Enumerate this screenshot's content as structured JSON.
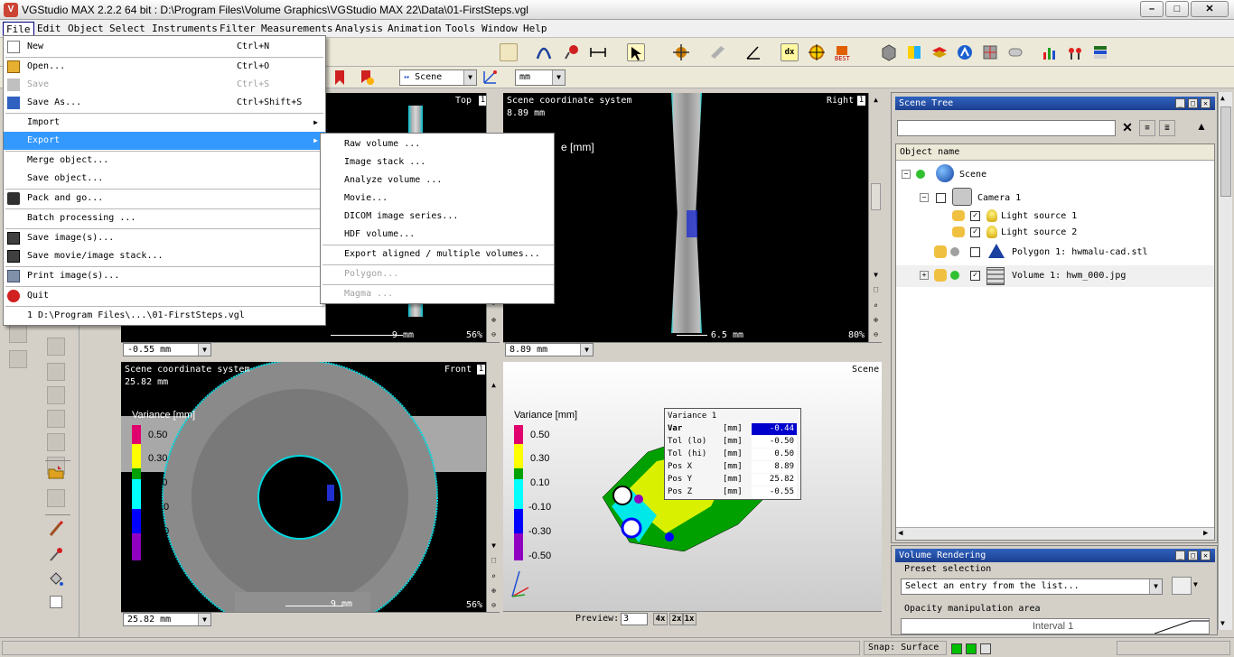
{
  "window": {
    "title": "VGStudio MAX 2.2.2 64 bit : D:\\Program Files\\Volume Graphics\\VGStudio MAX 22\\Data\\01-FirstSteps.vgl",
    "min_label": "–",
    "max_label": "□",
    "close_label": "✕"
  },
  "menubar": [
    "File",
    "Edit",
    "Object",
    "Select",
    "Instruments",
    "Filter",
    "Measurements",
    "Analysis",
    "Animation",
    "Tools",
    "Window",
    "Help"
  ],
  "file_menu": {
    "items": [
      {
        "label": "New",
        "shortcut": "Ctrl+N",
        "state": "normal"
      },
      {
        "label": "Open...",
        "shortcut": "Ctrl+O",
        "state": "normal"
      },
      {
        "label": "Save",
        "shortcut": "Ctrl+S",
        "state": "disabled"
      },
      {
        "label": "Save As...",
        "shortcut": "Ctrl+Shift+S",
        "state": "normal"
      },
      {
        "label": "Import",
        "shortcut": "",
        "state": "submenu"
      },
      {
        "label": "Export",
        "shortcut": "",
        "state": "highlight"
      },
      {
        "label": "Merge object...",
        "shortcut": "",
        "state": "normal"
      },
      {
        "label": "Save object...",
        "shortcut": "",
        "state": "normal"
      },
      {
        "label": "Pack and go...",
        "shortcut": "",
        "state": "normal"
      },
      {
        "label": "Batch processing ...",
        "shortcut": "",
        "state": "normal"
      },
      {
        "label": "Save image(s)...",
        "shortcut": "",
        "state": "normal"
      },
      {
        "label": "Save movie/image stack...",
        "shortcut": "",
        "state": "normal"
      },
      {
        "label": "Print image(s)...",
        "shortcut": "",
        "state": "normal"
      },
      {
        "label": "Quit",
        "shortcut": "",
        "state": "normal"
      },
      {
        "label": "1 D:\\Program Files\\...\\01-FirstSteps.vgl",
        "shortcut": "",
        "state": "normal"
      }
    ]
  },
  "export_menu": {
    "items": [
      {
        "label": "Raw volume ...",
        "state": "normal"
      },
      {
        "label": "Image stack ...",
        "state": "normal"
      },
      {
        "label": "Analyze volume ...",
        "state": "normal"
      },
      {
        "label": "Movie...",
        "state": "normal"
      },
      {
        "label": "DICOM image series...",
        "state": "normal"
      },
      {
        "label": "HDF volume...",
        "state": "normal"
      },
      {
        "label": "Export aligned / multiple volumes...",
        "state": "normal"
      },
      {
        "label": "Polygon...",
        "state": "disabled"
      },
      {
        "label": "Magma ...",
        "state": "disabled"
      }
    ]
  },
  "toolbar": {
    "scene_combo": "Scene",
    "unit_combo": "mm"
  },
  "viewports": {
    "top": {
      "name": "Top",
      "num": "1",
      "scale": "9 mm",
      "zoom": "56%",
      "coord": "-0.55 mm"
    },
    "right": {
      "name": "Right",
      "num": "1",
      "system": "Scene coordinate system",
      "pos": "8.89 mm",
      "scale": "6.5 mm",
      "zoom": "80%",
      "coord": "8.89 mm",
      "variance_partial": "e [mm]"
    },
    "front": {
      "name": "Front",
      "num": "1",
      "system": "Scene coordinate system",
      "pos": "25.82 mm",
      "scale": "9 mm",
      "zoom": "56%",
      "coord": "25.82 mm"
    },
    "scene": {
      "name": "Scene",
      "preview_label": "Preview:",
      "preview_value": "3",
      "zoom_buttons": [
        "4x",
        "2x",
        "1x"
      ]
    }
  },
  "legend": {
    "title": "Variance [mm]",
    "values": [
      "0.50",
      "0.30",
      "0.10",
      "-0.10",
      "-0.30",
      "-0.50"
    ],
    "colors": [
      "#e0006e",
      "#ffff00",
      "#00a000",
      "#00ffff",
      "#0000ff",
      "#9000c0"
    ]
  },
  "variance_box": {
    "title": "Variance 1",
    "rows": [
      {
        "name": "Var",
        "unit": "[mm]",
        "value": "-0.44"
      },
      {
        "name": "Tol (lo)",
        "unit": "[mm]",
        "value": "-0.50"
      },
      {
        "name": "Tol (hi)",
        "unit": "[mm]",
        "value": "0.50"
      },
      {
        "name": "Pos X",
        "unit": "[mm]",
        "value": "8.89"
      },
      {
        "name": "Pos Y",
        "unit": "[mm]",
        "value": "25.82"
      },
      {
        "name": "Pos Z",
        "unit": "[mm]",
        "value": "-0.55"
      }
    ]
  },
  "scene_tree": {
    "title": "Scene Tree",
    "column": "Object name",
    "nodes": [
      {
        "label": "Scene"
      },
      {
        "label": "Camera 1"
      },
      {
        "label": "Light source 1"
      },
      {
        "label": "Light source 2"
      },
      {
        "label": "Polygon 1: hwmalu-cad.stl"
      },
      {
        "label": "Volume 1: hwm_000.jpg"
      }
    ]
  },
  "volume_rendering": {
    "title": "Volume Rendering",
    "preset_label": "Preset selection",
    "preset_placeholder": "Select an entry from the list...",
    "opacity_label": "Opacity manipulation area",
    "interval_label": "Interval 1"
  },
  "statusbar": {
    "snap": "Snap: Surface"
  }
}
